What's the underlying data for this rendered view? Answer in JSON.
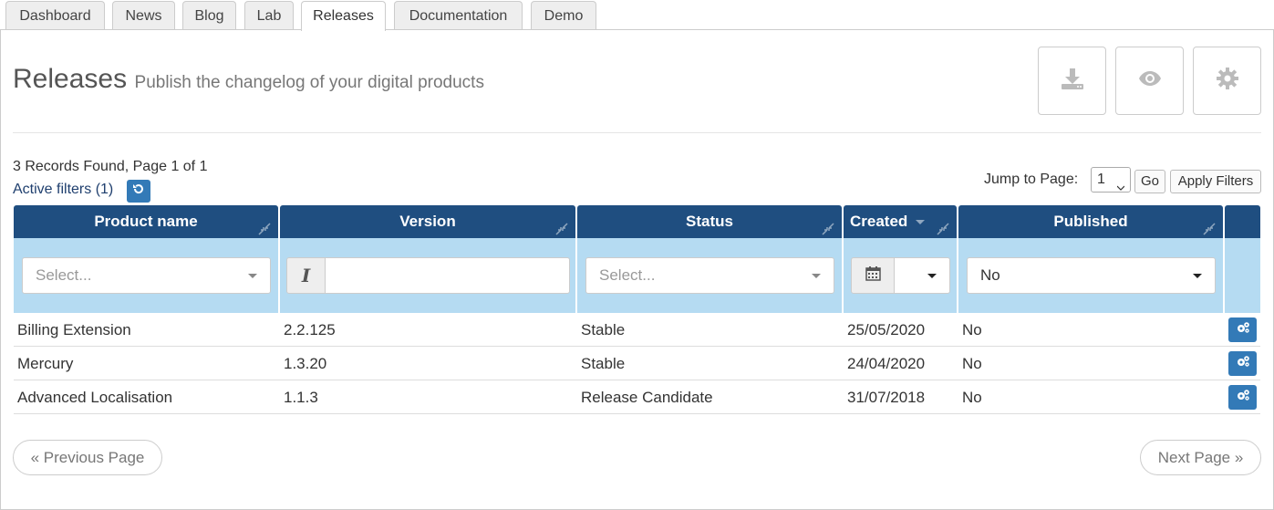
{
  "tabs": [
    "Dashboard",
    "News",
    "Blog",
    "Lab",
    "Releases",
    "Documentation",
    "Demo"
  ],
  "active_tab": "Releases",
  "header": {
    "title": "Releases",
    "subtitle": "Publish the changelog of your digital products",
    "buttons": [
      "download-icon",
      "eye-icon",
      "gear-icon"
    ]
  },
  "info": {
    "records": "3 Records Found, Page 1 of 1",
    "active_filters": "Active filters (1)",
    "jump_label": "Jump to Page:",
    "jump_value": "1",
    "go": "Go",
    "apply_filters": "Apply Filters"
  },
  "table": {
    "columns": [
      "Product name",
      "Version",
      "Status",
      "Created",
      "Published"
    ],
    "filters": {
      "product_placeholder": "Select...",
      "version_value": "",
      "status_placeholder": "Select...",
      "created_value": "",
      "published_value": "No"
    },
    "rows": [
      {
        "product": "Billing Extension",
        "version": "2.2.125",
        "status": "Stable",
        "created": "25/05/2020",
        "published": "No"
      },
      {
        "product": "Mercury",
        "version": "1.3.20",
        "status": "Stable",
        "created": "24/04/2020",
        "published": "No"
      },
      {
        "product": "Advanced Localisation",
        "version": "1.1.3",
        "status": "Release Candidate",
        "created": "31/07/2018",
        "published": "No"
      }
    ]
  },
  "pager": {
    "previous": "« Previous Page",
    "next": "Next Page »"
  },
  "colors": {
    "header_bg": "#1f4e80",
    "filter_bg": "#b5dbf2",
    "action_btn": "#337ab7"
  }
}
